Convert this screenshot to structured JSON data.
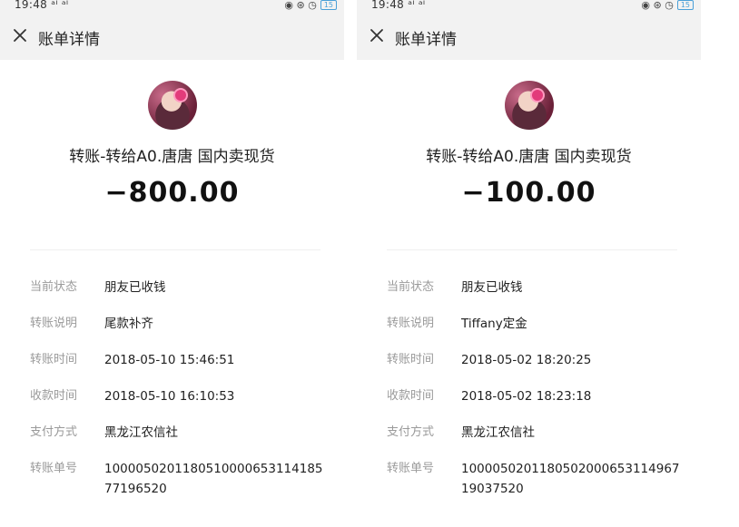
{
  "colors": {
    "topbar_bg": "#f2f2f2",
    "label": "#9a9a9a",
    "text": "#222222",
    "battery": "#4aa0d8"
  },
  "panels": [
    {
      "status": {
        "time": "19:48",
        "signal": "ᵃᴵ ᵃᴵ",
        "icons": "◉ ⊛ ◷",
        "battery": "15"
      },
      "header": {
        "close_icon": "close-icon",
        "title": "账单详情"
      },
      "payee": "转账-转给A0.唐唐 国内卖现货",
      "amount": "−800.00",
      "details": [
        {
          "label": "当前状态",
          "value": "朋友已收钱"
        },
        {
          "label": "转账说明",
          "value": "尾款补齐"
        },
        {
          "label": "转账时间",
          "value": "2018-05-10 15:46:51"
        },
        {
          "label": "收款时间",
          "value": "2018-05-10 16:10:53"
        },
        {
          "label": "支付方式",
          "value": "黑龙江农信社"
        },
        {
          "label": "转账单号",
          "value": "10000502011805100006531141857719652​0",
          "line1": "100005020118051000065311418​5",
          "line2": "77196520"
        }
      ]
    },
    {
      "status": {
        "time": "19:48",
        "signal": "ᵃᴵ ᵃᴵ",
        "icons": "◉ ⊛ ◷",
        "battery": "15"
      },
      "header": {
        "close_icon": "close-icon",
        "title": "账单详情"
      },
      "payee": "转账-转给A0.唐唐 国内卖现货",
      "amount": "−100.00",
      "details": [
        {
          "label": "当前状态",
          "value": "朋友已收钱"
        },
        {
          "label": "转账说明",
          "value": "Tiffany定金"
        },
        {
          "label": "转账时间",
          "value": "2018-05-02 18:20:25"
        },
        {
          "label": "收款时间",
          "value": "2018-05-02 18:23:18"
        },
        {
          "label": "支付方式",
          "value": "黑龙江农信社"
        },
        {
          "label": "转账单号",
          "value": "1000050201180502000653114967 19037520",
          "line1": "1000050201180502000653114967",
          "line2": "19037520"
        }
      ]
    }
  ]
}
